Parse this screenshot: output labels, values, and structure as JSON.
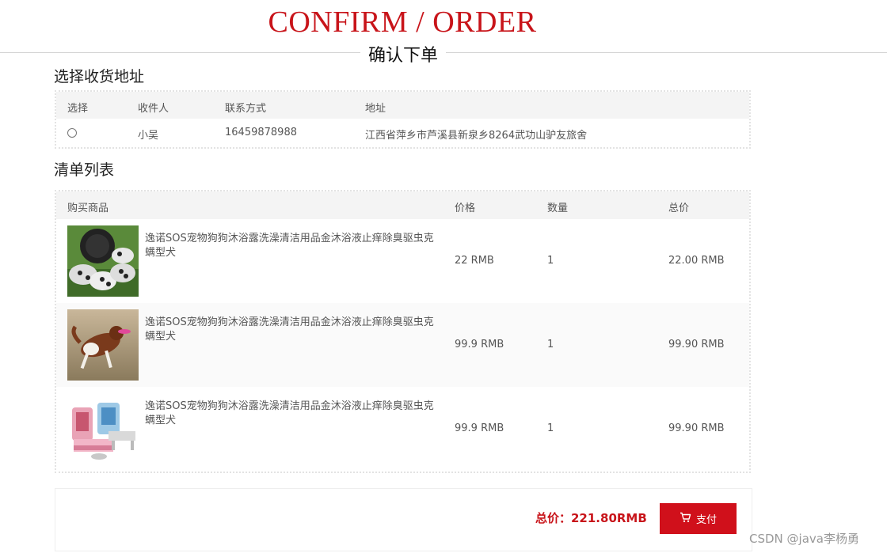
{
  "header": {
    "title_en": "CONFIRM / ORDER",
    "title_cn": "确认下单"
  },
  "address_section": {
    "title": "选择收货地址",
    "columns": [
      "选择",
      "收件人",
      "联系方式",
      "地址"
    ],
    "rows": [
      {
        "recipient": "小吴",
        "phone": "16459878988",
        "address": "江西省萍乡市芦溪县新泉乡8264武功山驴友旅舍",
        "selected": false
      }
    ]
  },
  "list_section": {
    "title": "清单列表",
    "columns": [
      "购买商品",
      "价格",
      "数量",
      "总价"
    ],
    "items": [
      {
        "name": "逸诺SOS宠物狗狗沐浴露洗澡清洁用品金沐浴液止痒除臭驱虫克螨型犬",
        "price": "22 RMB",
        "qty": "1",
        "total": "22.00 RMB",
        "image": "dog-shoes-photo"
      },
      {
        "name": "逸诺SOS宠物狗狗沐浴露洗澡清洁用品金沐浴液止痒除臭驱虫克螨型犬",
        "price": "99.9 RMB",
        "qty": "1",
        "total": "99.90 RMB",
        "image": "dog-frisbee-photo"
      },
      {
        "name": "逸诺SOS宠物狗狗沐浴露洗澡清洁用品金沐浴液止痒除臭驱虫克螨型犬",
        "price": "99.9 RMB",
        "qty": "1",
        "total": "99.90 RMB",
        "image": "pet-bed-photo"
      }
    ]
  },
  "footer": {
    "total_label": "总价：221.80RMB",
    "pay_label": "支付",
    "pay_icon": "cart-icon"
  },
  "watermark": "CSDN @java李杨勇",
  "colors": {
    "accent": "#c8141a",
    "button": "#d0101b",
    "header_bg": "#f4f4f4"
  }
}
